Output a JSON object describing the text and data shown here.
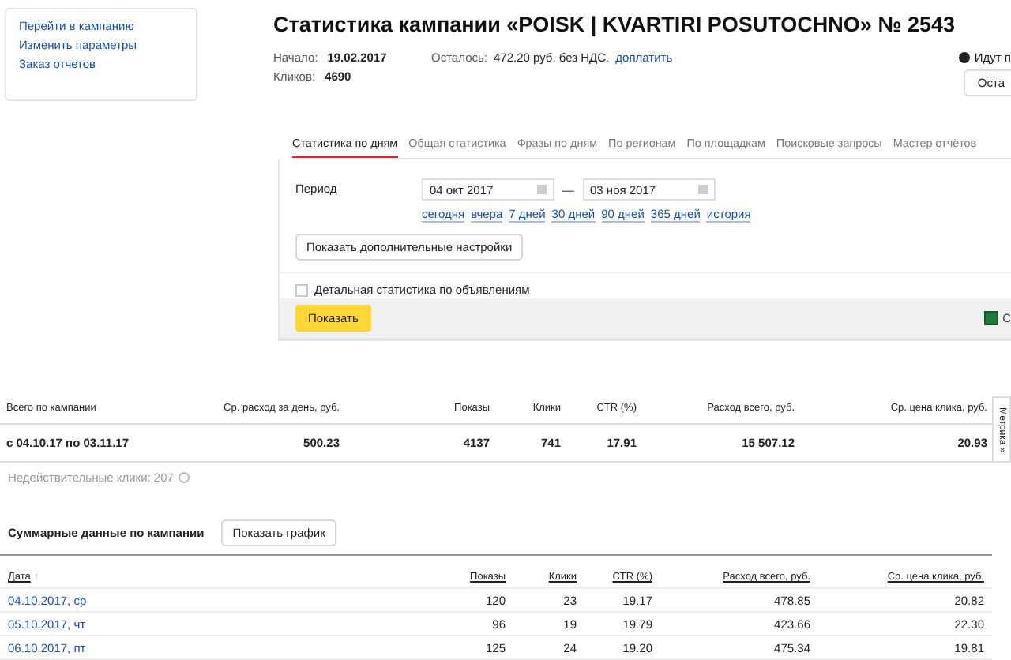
{
  "sidebar": {
    "links": [
      "Перейти в кампанию",
      "Изменить параметры",
      "Заказ отчетов"
    ]
  },
  "header": {
    "title": "Статистика кампании «POISK | KVARTIRI POSUTOCHNO» № 2543",
    "start_label": "Начало:",
    "start_value": "19.02.2017",
    "clicks_label": "Кликов:",
    "clicks_value": "4690",
    "remaining_label": "Осталось:",
    "remaining_value": "472.20 руб. без НДС.",
    "pay_link": "доплатить",
    "notice": "Идут п",
    "notice_button": "Оста"
  },
  "tabs": [
    {
      "label": "Статистика по дням",
      "selected": true
    },
    {
      "label": "Общая статистика",
      "selected": false
    },
    {
      "label": "Фразы по дням",
      "selected": false
    },
    {
      "label": "По регионам",
      "selected": false
    },
    {
      "label": "По площадкам",
      "selected": false
    },
    {
      "label": "Поисковые запросы",
      "selected": false
    },
    {
      "label": "Мастер отчётов",
      "selected": false
    }
  ],
  "filter": {
    "period_label": "Период",
    "date_from": "04 окт 2017",
    "date_separator": "—",
    "date_to": "03 ноя 2017",
    "quick_ranges": [
      "сегодня",
      "вчера",
      "7 дней",
      "30 дней",
      "90 дней",
      "365 дней",
      "история"
    ],
    "more_settings_button": "Показать дополнительные настройки",
    "detail_checkbox": {
      "label": "Детальная статистика по объявлениям",
      "checked": false
    },
    "submit_button": "Показать",
    "export_label": "С"
  },
  "totals": {
    "columns": [
      "Всего по кампании",
      "Ср. расход за день, руб.",
      "Показы",
      "Клики",
      "CTR (%)",
      "Расход всего, руб.",
      "Ср. цена клика, руб."
    ],
    "row": [
      "с 04.10.17 по 03.11.17",
      "500.23",
      "4137",
      "741",
      "17.91",
      "15 507.12",
      "20.93"
    ]
  },
  "invalid_clicks": "Недействительные клики: 207",
  "metrika_tab": "Метрика »",
  "summary": {
    "title": "Суммарные данные по кампании",
    "chart_button": "Показать график",
    "sort_mark": "↑",
    "columns": [
      "Дата",
      "Показы",
      "Клики",
      "CTR (%)",
      "Расход всего, руб.",
      "Ср. цена клика, руб."
    ],
    "rows": [
      [
        "04.10.2017, ср",
        "120",
        "23",
        "19.17",
        "478.85",
        "20.82"
      ],
      [
        "05.10.2017, чт",
        "96",
        "19",
        "19.79",
        "423.66",
        "22.30"
      ],
      [
        "06.10.2017, пт",
        "125",
        "24",
        "19.20",
        "475.34",
        "19.81"
      ]
    ]
  }
}
